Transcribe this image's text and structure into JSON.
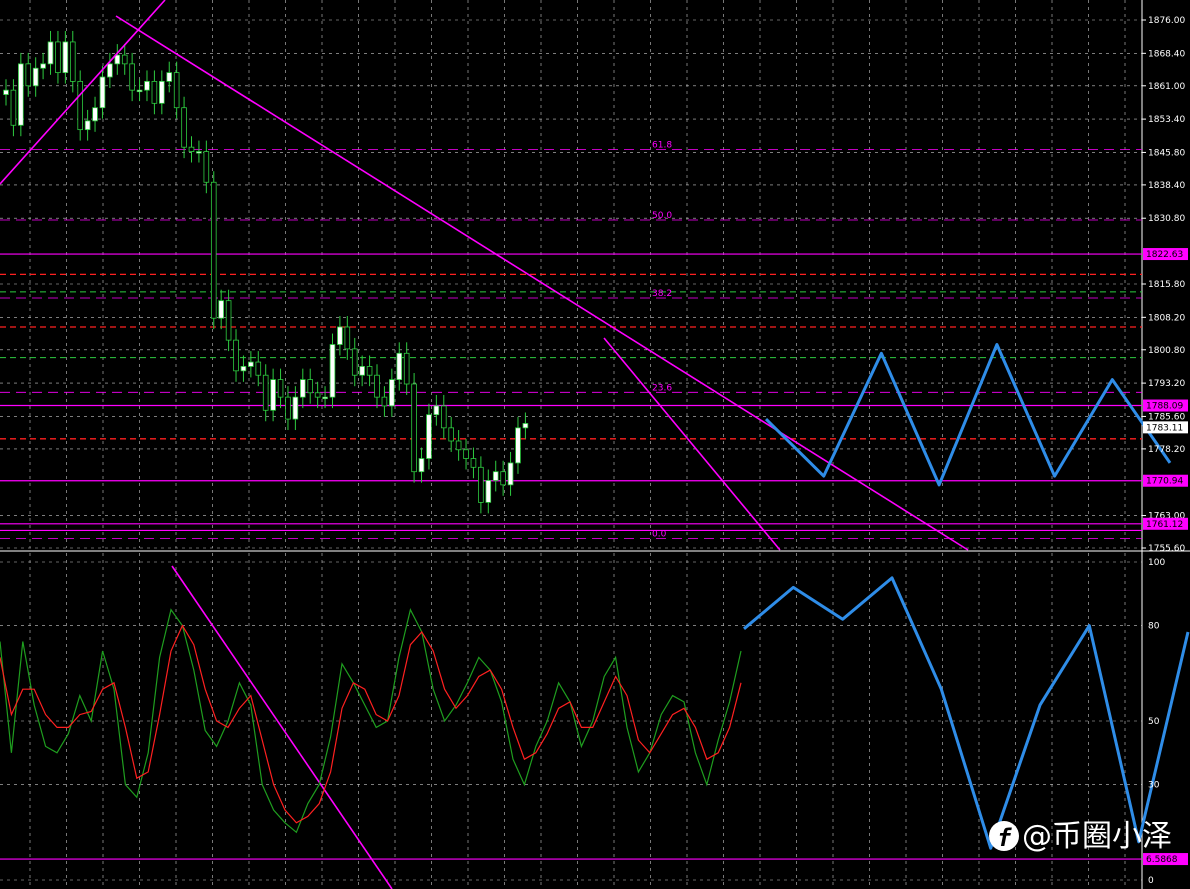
{
  "watermark": {
    "text": "@币圈小泽",
    "icon": "f-logo-icon"
  },
  "colors": {
    "background": "#000000",
    "grid": "#c8c8c8",
    "bull": "#ffffff",
    "bear": "#000000",
    "wick": "#2ecc40",
    "trendline": "#ff00ff",
    "forecast": "#2f8de8",
    "k_line": "#1f9e1f",
    "d_line": "#ff2020"
  },
  "chart_data": [
    {
      "type": "candlestick",
      "panel": "price",
      "y_ticks": [
        "1876.00",
        "1868.40",
        "1861.00",
        "1853.40",
        "1845.80",
        "1838.40",
        "1830.80",
        "1815.80",
        "1808.20",
        "1800.80",
        "1793.20",
        "1785.60",
        "1778.20",
        "1763.00",
        "1755.60"
      ],
      "ylim": [
        1755.6,
        1876.0
      ],
      "current_price_label": "1783.11",
      "level_tags": [
        {
          "label": "1822.63",
          "value": 1822.63
        },
        {
          "label": "1788.09",
          "value": 1788.09
        },
        {
          "label": "1770.94",
          "value": 1770.94
        },
        {
          "label": "1761.12",
          "value": 1761.12
        }
      ],
      "fib_labels": [
        {
          "label": "61.8",
          "value": 1846.5
        },
        {
          "label": "50.0",
          "value": 1830.4
        },
        {
          "label": "38.2",
          "value": 1812.6
        },
        {
          "label": "23.6",
          "value": 1791.1
        },
        {
          "label": "0.0",
          "value": 1757.8
        }
      ],
      "candles_close": [
        1860,
        1852,
        1866,
        1861,
        1865,
        1866,
        1871,
        1864,
        1871,
        1862,
        1851,
        1853,
        1856,
        1863,
        1866,
        1868,
        1866,
        1860,
        1860,
        1862,
        1857,
        1862,
        1864,
        1856,
        1847,
        1846,
        1846,
        1839,
        1808,
        1812,
        1803,
        1796,
        1797,
        1798,
        1795,
        1787,
        1794,
        1790,
        1785,
        1790,
        1794,
        1791,
        1790,
        1790,
        1802,
        1806,
        1801,
        1795,
        1797,
        1795,
        1790,
        1788,
        1794,
        1800,
        1793,
        1773,
        1776,
        1786,
        1788,
        1783,
        1780,
        1778,
        1776,
        1774,
        1766,
        1771,
        1773,
        1770,
        1775,
        1783,
        1784
      ],
      "forecast": [
        1785,
        1772,
        1800,
        1770,
        1802,
        1772,
        1794,
        1775
      ]
    },
    {
      "type": "line",
      "panel": "stochastic",
      "y_ticks": [
        "100",
        "80",
        "50",
        "30",
        "0"
      ],
      "ylim": [
        0,
        100
      ],
      "level_tag": "6.5868",
      "series": [
        {
          "values": [
            75,
            40,
            75,
            55,
            42,
            40,
            46,
            58,
            50,
            72,
            60,
            30,
            26,
            40,
            70,
            85,
            80,
            66,
            47,
            42,
            50,
            62,
            55,
            30,
            22,
            18,
            15,
            24,
            30,
            45,
            68,
            62,
            55,
            48,
            50,
            70,
            85,
            78,
            60,
            50,
            55,
            62,
            70,
            66,
            56,
            38,
            30,
            42,
            50,
            62,
            56,
            42,
            50,
            64,
            70,
            48,
            34,
            40,
            52,
            58,
            56,
            40,
            30,
            44,
            56,
            72
          ]
        },
        {
          "values": [
            70,
            52,
            60,
            60,
            52,
            48,
            48,
            52,
            53,
            60,
            62,
            48,
            32,
            34,
            52,
            72,
            80,
            74,
            60,
            50,
            48,
            54,
            58,
            44,
            30,
            22,
            18,
            20,
            24,
            34,
            54,
            62,
            60,
            52,
            50,
            58,
            74,
            78,
            72,
            60,
            54,
            58,
            64,
            66,
            60,
            48,
            38,
            40,
            46,
            54,
            56,
            48,
            48,
            56,
            64,
            58,
            44,
            40,
            46,
            52,
            54,
            48,
            38,
            40,
            48,
            62
          ]
        }
      ],
      "forecast": [
        79,
        92,
        82,
        95,
        60,
        10,
        55,
        80,
        12,
        78
      ]
    }
  ]
}
